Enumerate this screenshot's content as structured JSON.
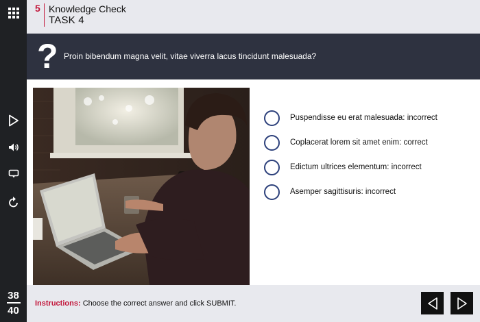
{
  "header": {
    "task_number": "5",
    "title": "Knowledge Check",
    "subtitle": "TASK 4"
  },
  "question": {
    "icon": "question-mark-icon",
    "text": "Proin bibendum magna velit, vitae viverra lacus tincidunt malesuada?"
  },
  "options": [
    {
      "label": "Puspendisse eu erat malesuada: incorrect"
    },
    {
      "label": "Coplacerat lorem sit amet enim: correct"
    },
    {
      "label": "Edictum ultrices elementum: incorrect"
    },
    {
      "label": "Asemper sagittisuris: incorrect"
    }
  ],
  "sidebar": {
    "icons": [
      "grid-menu-icon",
      "play-icon",
      "audio-icon",
      "caption-icon",
      "replay-icon"
    ],
    "page_current": "38",
    "page_total": "40"
  },
  "footer": {
    "instructions_label": "Instructions:",
    "instructions_text": "Choose the correct answer and click SUBMIT."
  },
  "colors": {
    "accent": "#c2163a",
    "question_bar": "#2e3240",
    "sidebar": "#1f2124",
    "radio_border": "#2b3f7a",
    "panel_bg": "#e8e9ee"
  }
}
